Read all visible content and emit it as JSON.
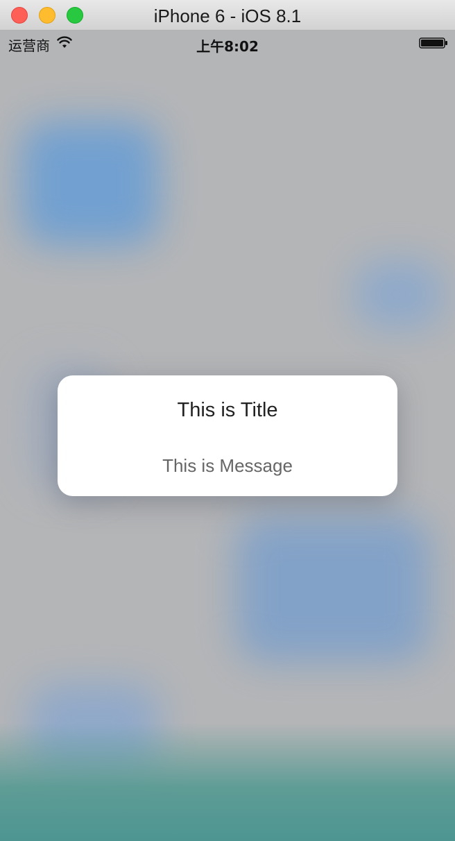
{
  "window": {
    "title": "iPhone 6 - iOS 8.1"
  },
  "status_bar": {
    "carrier": "运营商",
    "time": "上午8:02",
    "wifi_icon": "wifi-icon",
    "battery_icon": "battery-icon"
  },
  "alert": {
    "title": "This is Title",
    "message": "This is Message"
  },
  "colors": {
    "close": "#fe5f57",
    "minimize": "#febc2e",
    "maximize": "#28c840",
    "background": "#b4b5b7",
    "bottom_accent": "#4d9591"
  }
}
